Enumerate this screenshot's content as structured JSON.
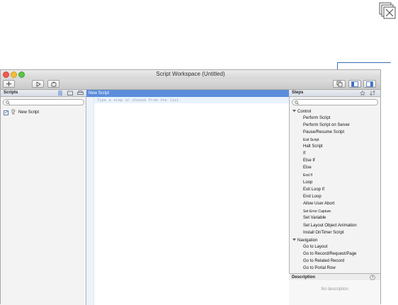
{
  "window": {
    "title": "Script Workspace (Untitled)"
  },
  "scripts_panel": {
    "header": "Scripts",
    "search_placeholder": "",
    "scripts": [
      {
        "name": "New Script",
        "checked": true
      }
    ]
  },
  "editor": {
    "tab_title": "New Script",
    "placeholder": "Type a step or choose from the list."
  },
  "steps_panel": {
    "header": "Steps",
    "search_placeholder": "",
    "categories": [
      {
        "label": "Control"
      },
      {
        "label": "Navigation"
      }
    ],
    "control_items": [
      "Perform Script",
      "Perform Script on Server",
      "Pause/Resume Script",
      "Exit Script",
      "Halt Script",
      "If",
      "Else If",
      "Else",
      "End If",
      "Loop",
      "Exit Loop If",
      "End Loop",
      "Allow User Abort",
      "Set Error Capture",
      "Set Variable",
      "Set Layout Object Animation",
      "Install OnTimer Script"
    ],
    "navigation_items": [
      "Go to Layout",
      "Go to Record/Request/Page",
      "Go to Related Record",
      "Go to Portal Row"
    ]
  },
  "description": {
    "header": "Description",
    "placeholder": "No description"
  },
  "accent_color": "#5b8ddb"
}
